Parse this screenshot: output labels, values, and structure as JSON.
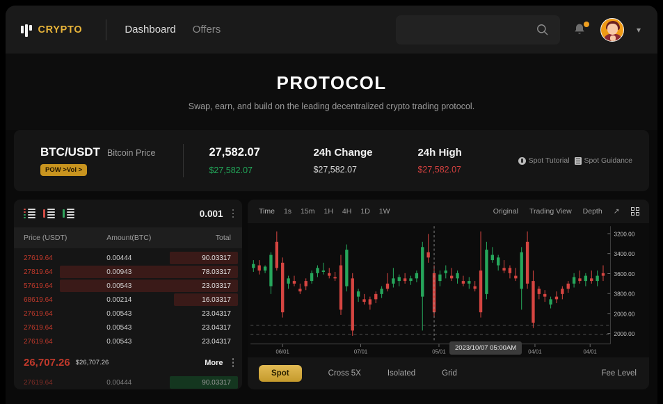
{
  "header": {
    "brand": "CRYPTO",
    "nav": [
      {
        "label": "Dashboard",
        "active": true
      },
      {
        "label": "Offers",
        "active": false
      }
    ],
    "search_placeholder": "",
    "search_value": "",
    "icons": {
      "search": "search-icon",
      "bell": "notification-bell-icon",
      "avatar": "user-avatar",
      "chevron": "chevron-down-icon"
    }
  },
  "hero": {
    "title": "PROTOCOL",
    "subtitle": "Swap, earn, and build on the leading decentralized crypto trading protocol."
  },
  "ticker": {
    "symbol": "BTC/USDT",
    "symbol_sub": "Bitcoin Price",
    "badge": "POW >Vol >",
    "price_value": "27,582.07",
    "price_sub": "$27,582.07",
    "change_label": "24h Change",
    "change_value": "$27,582.07",
    "high_label": "24h High",
    "high_value": "$27,582.07",
    "tutorial_link": "Spot Tutorial",
    "guidance_link": "Spot Guidance",
    "colors": {
      "green": "#22a95a",
      "red": "#d3403f",
      "badge_bg": "#c8941f"
    }
  },
  "orderbook": {
    "quantity": "0.001",
    "columns": [
      "Price (USDT)",
      "Amount(BTC)",
      "Total"
    ],
    "asks": [
      {
        "price": "27619.64",
        "amount": "0.00444",
        "total": "90.03317",
        "depth": 30
      },
      {
        "price": "27819.64",
        "amount": "0.00943",
        "total": "78.03317",
        "depth": 78
      },
      {
        "price": "57619.64",
        "amount": "0.00543",
        "total": "23.03317",
        "depth": 78
      },
      {
        "price": "68619.64",
        "amount": "0.00214",
        "total": "16.03317",
        "depth": 28
      },
      {
        "price": "27619.64",
        "amount": "0.00543",
        "total": "23.04317",
        "depth": 0
      },
      {
        "price": "27619.64",
        "amount": "0.00543",
        "total": "23.04317",
        "depth": 0
      },
      {
        "price": "27619.64",
        "amount": "0.00543",
        "total": "23.04317",
        "depth": 0
      }
    ],
    "mid_price": "26,707.26",
    "mid_price_sub": "$26,707.26",
    "more_label": "More",
    "bids": [
      {
        "price": "27619.64",
        "amount": "0.00444",
        "total": "90.03317",
        "depth": 30
      }
    ]
  },
  "chart": {
    "timeframes": [
      "Time",
      "1s",
      "15m",
      "1H",
      "4H",
      "1D",
      "1W"
    ],
    "view_modes": [
      "Original",
      "Trading View",
      "Depth"
    ],
    "tooltip": "2023/10/07 05:00AM",
    "icons": {
      "expand": "expand-icon",
      "grid": "grid-layout-icon"
    },
    "tabs": [
      {
        "label": "Spot",
        "active": true
      },
      {
        "label": "Cross 5X",
        "active": false
      },
      {
        "label": "Isolated",
        "active": false
      },
      {
        "label": "Grid",
        "active": false
      }
    ],
    "fee_label": "Fee Level"
  },
  "chart_data": {
    "type": "candlestick",
    "title": "",
    "xlabel": "",
    "ylabel": "",
    "y_ticks": [
      "3200.00",
      "3400.00",
      "3600.00",
      "3800.00",
      "2000.00",
      "2000.00"
    ],
    "x_ticks": [
      "06/01",
      "07/01",
      "05/01",
      "04/01",
      "04/01"
    ],
    "grid": false,
    "legend": "none",
    "crosshair_label": "2023/10/07 05:00AM",
    "colors": {
      "up": "#26a65b",
      "down": "#d64541"
    },
    "candles": [
      {
        "o": 60,
        "h": 66,
        "l": 57,
        "c": 63,
        "d": "up"
      },
      {
        "o": 62,
        "h": 66,
        "l": 55,
        "c": 58,
        "d": "down"
      },
      {
        "o": 58,
        "h": 62,
        "l": 56,
        "c": 61,
        "d": "up"
      },
      {
        "o": 46,
        "h": 72,
        "l": 40,
        "c": 70,
        "d": "up"
      },
      {
        "o": 80,
        "h": 88,
        "l": 58,
        "c": 60,
        "d": "down"
      },
      {
        "o": 64,
        "h": 68,
        "l": 22,
        "c": 26,
        "d": "down"
      },
      {
        "o": 48,
        "h": 54,
        "l": 44,
        "c": 52,
        "d": "up"
      },
      {
        "o": 50,
        "h": 54,
        "l": 46,
        "c": 48,
        "d": "down"
      },
      {
        "o": 44,
        "h": 48,
        "l": 40,
        "c": 42,
        "d": "down"
      },
      {
        "o": 46,
        "h": 52,
        "l": 43,
        "c": 50,
        "d": "down"
      },
      {
        "o": 50,
        "h": 58,
        "l": 48,
        "c": 56,
        "d": "up"
      },
      {
        "o": 56,
        "h": 62,
        "l": 53,
        "c": 60,
        "d": "up"
      },
      {
        "o": 58,
        "h": 64,
        "l": 55,
        "c": 57,
        "d": "up"
      },
      {
        "o": 56,
        "h": 60,
        "l": 52,
        "c": 54,
        "d": "down"
      },
      {
        "o": 53,
        "h": 57,
        "l": 50,
        "c": 52,
        "d": "down"
      },
      {
        "o": 62,
        "h": 70,
        "l": 24,
        "c": 28,
        "d": "down"
      },
      {
        "o": 46,
        "h": 78,
        "l": 42,
        "c": 74,
        "d": "up"
      },
      {
        "o": 52,
        "h": 56,
        "l": 8,
        "c": 12,
        "d": "down"
      },
      {
        "o": 38,
        "h": 44,
        "l": 34,
        "c": 42,
        "d": "up"
      },
      {
        "o": 36,
        "h": 40,
        "l": 32,
        "c": 34,
        "d": "down"
      },
      {
        "o": 32,
        "h": 38,
        "l": 28,
        "c": 36,
        "d": "down"
      },
      {
        "o": 36,
        "h": 42,
        "l": 33,
        "c": 40,
        "d": "down"
      },
      {
        "o": 40,
        "h": 46,
        "l": 37,
        "c": 44,
        "d": "up"
      },
      {
        "o": 44,
        "h": 56,
        "l": 42,
        "c": 48,
        "d": "down"
      },
      {
        "o": 48,
        "h": 60,
        "l": 45,
        "c": 52,
        "d": "up"
      },
      {
        "o": 50,
        "h": 55,
        "l": 46,
        "c": 53,
        "d": "up"
      },
      {
        "o": 52,
        "h": 56,
        "l": 48,
        "c": 50,
        "d": "down"
      },
      {
        "o": 50,
        "h": 54,
        "l": 47,
        "c": 52,
        "d": "up"
      },
      {
        "o": 52,
        "h": 58,
        "l": 49,
        "c": 56,
        "d": "up"
      },
      {
        "o": 38,
        "h": 80,
        "l": 12,
        "c": 76,
        "d": "up"
      },
      {
        "o": 72,
        "h": 86,
        "l": 64,
        "c": 68,
        "d": "down"
      },
      {
        "o": 56,
        "h": 62,
        "l": 22,
        "c": 26,
        "d": "down"
      },
      {
        "o": 50,
        "h": 58,
        "l": 46,
        "c": 55,
        "d": "up"
      },
      {
        "o": 56,
        "h": 62,
        "l": 52,
        "c": 58,
        "d": "up"
      },
      {
        "o": 54,
        "h": 60,
        "l": 50,
        "c": 52,
        "d": "down"
      },
      {
        "o": 52,
        "h": 58,
        "l": 48,
        "c": 56,
        "d": "up"
      },
      {
        "o": 50,
        "h": 54,
        "l": 46,
        "c": 48,
        "d": "down"
      },
      {
        "o": 48,
        "h": 53,
        "l": 44,
        "c": 50,
        "d": "up"
      },
      {
        "o": 46,
        "h": 50,
        "l": 42,
        "c": 44,
        "d": "down"
      },
      {
        "o": 58,
        "h": 88,
        "l": 22,
        "c": 26,
        "d": "down"
      },
      {
        "o": 40,
        "h": 80,
        "l": 36,
        "c": 74,
        "d": "up"
      },
      {
        "o": 70,
        "h": 76,
        "l": 64,
        "c": 66,
        "d": "up"
      },
      {
        "o": 62,
        "h": 70,
        "l": 58,
        "c": 68,
        "d": "up"
      },
      {
        "o": 60,
        "h": 66,
        "l": 56,
        "c": 58,
        "d": "down"
      },
      {
        "o": 56,
        "h": 62,
        "l": 52,
        "c": 60,
        "d": "down"
      },
      {
        "o": 54,
        "h": 60,
        "l": 50,
        "c": 52,
        "d": "down"
      },
      {
        "o": 44,
        "h": 76,
        "l": 28,
        "c": 72,
        "d": "up"
      },
      {
        "o": 80,
        "h": 88,
        "l": 44,
        "c": 48,
        "d": "down"
      },
      {
        "o": 50,
        "h": 58,
        "l": 14,
        "c": 18,
        "d": "down"
      },
      {
        "o": 40,
        "h": 46,
        "l": 36,
        "c": 44,
        "d": "down"
      },
      {
        "o": 38,
        "h": 43,
        "l": 34,
        "c": 40,
        "d": "down"
      },
      {
        "o": 32,
        "h": 38,
        "l": 29,
        "c": 36,
        "d": "up"
      },
      {
        "o": 36,
        "h": 42,
        "l": 33,
        "c": 38,
        "d": "down"
      },
      {
        "o": 40,
        "h": 46,
        "l": 36,
        "c": 44,
        "d": "down"
      },
      {
        "o": 44,
        "h": 50,
        "l": 41,
        "c": 48,
        "d": "down"
      },
      {
        "o": 48,
        "h": 56,
        "l": 45,
        "c": 53,
        "d": "up"
      },
      {
        "o": 52,
        "h": 58,
        "l": 48,
        "c": 50,
        "d": "down"
      },
      {
        "o": 50,
        "h": 56,
        "l": 46,
        "c": 54,
        "d": "up"
      },
      {
        "o": 52,
        "h": 58,
        "l": 48,
        "c": 50,
        "d": "down"
      },
      {
        "o": 50,
        "h": 58,
        "l": 46,
        "c": 54,
        "d": "up"
      },
      {
        "o": 54,
        "h": 62,
        "l": 50,
        "c": 56,
        "d": "down"
      }
    ]
  }
}
